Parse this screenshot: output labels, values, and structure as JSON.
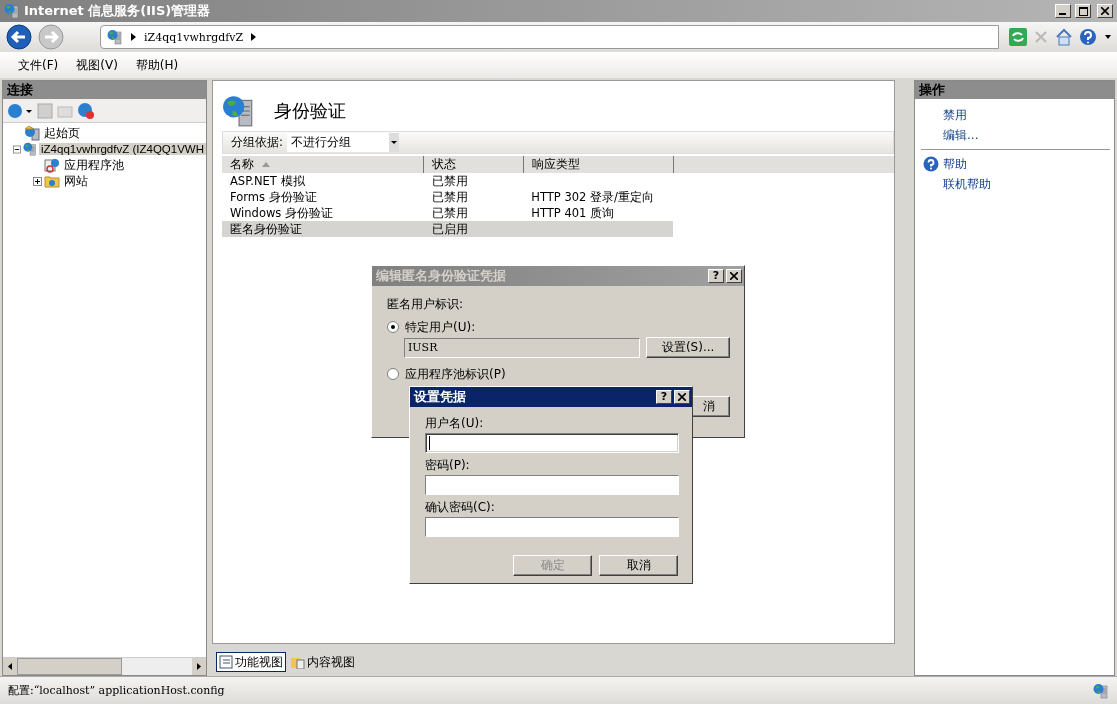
{
  "window": {
    "title": "Internet 信息服务(IIS)管理器",
    "active": false
  },
  "address": {
    "segments": [
      "iZ4qq1vwhrgdfvZ"
    ]
  },
  "menu": [
    "文件(F)",
    "视图(V)",
    "帮助(H)"
  ],
  "connections": {
    "title": "连接",
    "tree": [
      {
        "label": "起始页",
        "kind": "start",
        "selected": false
      },
      {
        "label": "iZ4qq1vwhrgdfvZ (IZ4QQ1VWH",
        "kind": "server",
        "selected": true,
        "expanded": true,
        "children": [
          {
            "label": "应用程序池",
            "kind": "pool",
            "selected": false
          },
          {
            "label": "网站",
            "kind": "sites",
            "selected": false,
            "expanded": false
          }
        ]
      }
    ]
  },
  "feature": {
    "title": "身份验证",
    "group_by": {
      "label": "分组依据:",
      "value": "不进行分组"
    },
    "columns": [
      {
        "label": "名称",
        "sorted": true
      },
      {
        "label": "状态",
        "sorted": false
      },
      {
        "label": "响应类型",
        "sorted": false
      }
    ],
    "rows": [
      {
        "cells": [
          "ASP.NET 模拟",
          "已禁用"
        ],
        "selected": false
      },
      {
        "cells": [
          "Forms 身份验证",
          "已禁用",
          "HTTP 302 登录/重定向"
        ],
        "selected": false
      },
      {
        "cells": [
          "Windows 身份验证",
          "已禁用",
          "HTTP 401 质询"
        ],
        "selected": false
      },
      {
        "cells": [
          "匿名身份验证",
          "已启用"
        ],
        "selected": true
      }
    ]
  },
  "views": [
    {
      "label": "功能视图",
      "selected": true
    },
    {
      "label": "内容视图",
      "selected": false
    }
  ],
  "actions": {
    "title": "操作",
    "groups": [
      [
        {
          "label": "禁用",
          "kind": "plain"
        },
        {
          "label": "编辑...",
          "kind": "plain"
        }
      ],
      [
        {
          "label": "帮助",
          "kind": "help"
        },
        {
          "label": "联机帮助",
          "kind": "plain"
        }
      ]
    ]
  },
  "status_bar": "配置:“localhost” applicationHost.config",
  "anonymous_dialog": {
    "title": "编辑匿名身份验证凭据",
    "active": false,
    "help": "?",
    "label": "匿名用户标识:",
    "options": [
      {
        "label": "特定用户(U):",
        "selected": true
      },
      {
        "label": "应用程序池标识(P)",
        "selected": false
      }
    ],
    "user_value": "IUSR",
    "set_button": "设置(S)...",
    "hidden_button": "消"
  },
  "credentials_dialog": {
    "title": "设置凭据",
    "active": true,
    "help": "?",
    "fields": [
      {
        "label": "用户名(U):",
        "focused": true
      },
      {
        "label": "密码(P):",
        "focused": false
      },
      {
        "label": "确认密码(C):",
        "focused": false
      }
    ],
    "buttons": [
      {
        "label": "确定",
        "disabled": true
      },
      {
        "label": "取消",
        "disabled": false
      }
    ]
  }
}
